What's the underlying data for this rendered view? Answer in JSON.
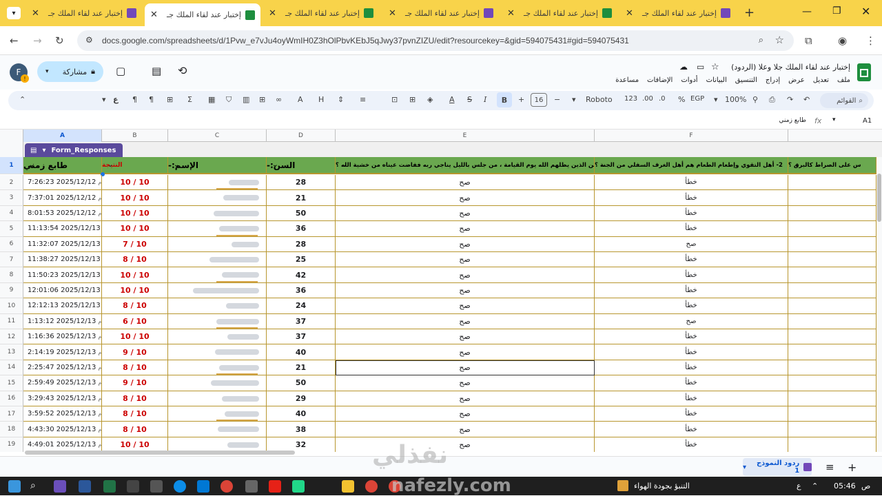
{
  "browser": {
    "tabs": [
      {
        "title": "إختبار عند لقاء الملك جـ",
        "kind": "form",
        "active": false
      },
      {
        "title": "إختبار عند لقاء الملك جـ",
        "kind": "sheet",
        "active": true
      },
      {
        "title": "إختبار عند لقاء الملك جـ",
        "kind": "sheet",
        "active": false
      },
      {
        "title": "إختبار عند لقاء الملك جـ",
        "kind": "form",
        "active": false
      },
      {
        "title": "إختبار عند لقاء الملك جـ",
        "kind": "sheet",
        "active": false
      },
      {
        "title": "إختبار عند لقاء الملك جـ",
        "kind": "form",
        "active": false
      }
    ],
    "url": "docs.google.com/spreadsheets/d/1Pvw_e7vJu4oyWmIH0Z3hOlPbvKEbJ5qJwy37pvnZIZU/edit?resourcekey=&gid=594075431#gid=594075431"
  },
  "doc": {
    "title": "إختبار  عند لقاء الملك جلا وعلا (الردود)",
    "menus": [
      "ملف",
      "تعديل",
      "عرض",
      "إدراج",
      "التنسيق",
      "البيانات",
      "أدوات",
      "الإضافات",
      "مساعدة"
    ],
    "share_label": "مشاركة",
    "avatar_letter": "F"
  },
  "toolbar": {
    "search_placeholder": "القوائم",
    "zoom": "100%",
    "currency": "EGP",
    "percent": "%",
    "dec_less": ".0",
    "dec_more": ".00",
    "num_fmt": "123",
    "font": "Roboto",
    "font_size": "16",
    "bold": "B",
    "italic": "I",
    "strike": "S",
    "text_color": "A",
    "fx_sigma": "Σ",
    "rtl_mark": "ع"
  },
  "formula": {
    "cell_ref": "A1",
    "content": "طابع زمني"
  },
  "columns": [
    "A",
    "B",
    "C",
    "D",
    "E",
    "F"
  ],
  "table_name": "Form_Responses",
  "headers": {
    "A": "طابع زمني",
    "B": "النتيجة",
    "C": "الإسم:-",
    "D": "السن:-",
    "E": "1- من الذين يظلهم الله يوم القيامة ، من جلس بالليل يناجي ربه ففاضت عيناه من خشية الله ؟",
    "F": "2- أهل التقوي وإطعام الطعام هم أهل الغرف السفلي من الجنة ؟",
    "G": "س على الصراط كالبرق ؟"
  },
  "rows": [
    {
      "n": "2",
      "ts": "7:26:23 2025/12/12",
      "ampm": "م",
      "score": "10 / 10",
      "age": "28",
      "e": "صح",
      "f": "خطأ"
    },
    {
      "n": "3",
      "ts": "7:37:01 2025/12/12",
      "ampm": "م",
      "score": "10 / 10",
      "age": "21",
      "e": "صح",
      "f": "خطأ"
    },
    {
      "n": "4",
      "ts": "8:01:53 2025/12/12",
      "ampm": "م",
      "score": "10 / 10",
      "age": "50",
      "e": "صح",
      "f": "خطأ"
    },
    {
      "n": "5",
      "ts": "11:13:54 2025/12/13",
      "ampm": "ص",
      "score": "10 / 10",
      "age": "36",
      "e": "صح",
      "f": "خطأ"
    },
    {
      "n": "6",
      "ts": "11:32:07 2025/12/13",
      "ampm": "ص",
      "score": "7 / 10",
      "age": "28",
      "e": "صح",
      "f": "صح"
    },
    {
      "n": "7",
      "ts": "11:38:27 2025/12/13",
      "ampm": "ص",
      "score": "8 / 10",
      "age": "25",
      "e": "صح",
      "f": "خطأ"
    },
    {
      "n": "8",
      "ts": "11:50:23 2025/12/13",
      "ampm": "ص",
      "score": "10 / 10",
      "age": "42",
      "e": "صح",
      "f": "خطأ"
    },
    {
      "n": "9",
      "ts": "12:01:06 2025/12/13",
      "ampm": "م",
      "score": "10 / 10",
      "age": "36",
      "e": "صح",
      "f": "خطأ"
    },
    {
      "n": "10",
      "ts": "12:12:13 2025/12/13",
      "ampm": "م",
      "score": "8 / 10",
      "age": "24",
      "e": "صح",
      "f": "خطأ"
    },
    {
      "n": "11",
      "ts": "1:13:12 2025/12/13",
      "ampm": "م",
      "score": "6 / 10",
      "age": "37",
      "e": "صح",
      "f": "صح"
    },
    {
      "n": "12",
      "ts": "1:16:36 2025/12/13",
      "ampm": "م",
      "score": "10 / 10",
      "age": "37",
      "e": "صح",
      "f": "خطأ"
    },
    {
      "n": "13",
      "ts": "2:14:19 2025/12/13",
      "ampm": "م",
      "score": "9 / 10",
      "age": "40",
      "e": "صح",
      "f": "خطأ"
    },
    {
      "n": "14",
      "ts": "2:25:47 2025/12/13",
      "ampm": "م",
      "score": "8 / 10",
      "age": "21",
      "e": "صح",
      "f": "خطأ"
    },
    {
      "n": "15",
      "ts": "2:59:49 2025/12/13",
      "ampm": "م",
      "score": "9 / 10",
      "age": "50",
      "e": "صح",
      "f": "خطأ"
    },
    {
      "n": "16",
      "ts": "3:29:43 2025/12/13",
      "ampm": "م",
      "score": "8 / 10",
      "age": "29",
      "e": "صح",
      "f": "خطأ"
    },
    {
      "n": "17",
      "ts": "3:59:52 2025/12/13",
      "ampm": "م",
      "score": "8 / 10",
      "age": "40",
      "e": "صح",
      "f": "خطأ"
    },
    {
      "n": "18",
      "ts": "4:43:30 2025/12/13",
      "ampm": "م",
      "score": "8 / 10",
      "age": "38",
      "e": "صح",
      "f": "خطأ"
    },
    {
      "n": "19",
      "ts": "4:49:01 2025/12/13",
      "ampm": "م",
      "score": "10 / 10",
      "age": "32",
      "e": "صح",
      "f": "خطأ"
    }
  ],
  "sheet_tab": "ردود النموذج 1",
  "watermark": "نفذلي",
  "watermark_en": "nafezly.com",
  "taskbar": {
    "weather": "التنبؤ بجودة الهواء",
    "time": "05:46",
    "ampm": "ص",
    "lang": "ع"
  }
}
